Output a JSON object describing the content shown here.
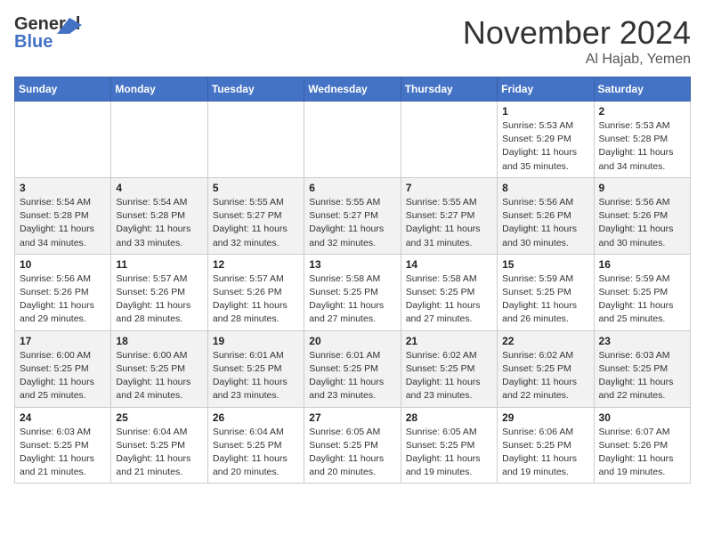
{
  "header": {
    "logo_line1": "General",
    "logo_line2": "Blue",
    "month": "November 2024",
    "location": "Al Hajab, Yemen"
  },
  "weekdays": [
    "Sunday",
    "Monday",
    "Tuesday",
    "Wednesday",
    "Thursday",
    "Friday",
    "Saturday"
  ],
  "weeks": [
    [
      {
        "day": "",
        "info": ""
      },
      {
        "day": "",
        "info": ""
      },
      {
        "day": "",
        "info": ""
      },
      {
        "day": "",
        "info": ""
      },
      {
        "day": "",
        "info": ""
      },
      {
        "day": "1",
        "info": "Sunrise: 5:53 AM\nSunset: 5:29 PM\nDaylight: 11 hours\nand 35 minutes."
      },
      {
        "day": "2",
        "info": "Sunrise: 5:53 AM\nSunset: 5:28 PM\nDaylight: 11 hours\nand 34 minutes."
      }
    ],
    [
      {
        "day": "3",
        "info": "Sunrise: 5:54 AM\nSunset: 5:28 PM\nDaylight: 11 hours\nand 34 minutes."
      },
      {
        "day": "4",
        "info": "Sunrise: 5:54 AM\nSunset: 5:28 PM\nDaylight: 11 hours\nand 33 minutes."
      },
      {
        "day": "5",
        "info": "Sunrise: 5:55 AM\nSunset: 5:27 PM\nDaylight: 11 hours\nand 32 minutes."
      },
      {
        "day": "6",
        "info": "Sunrise: 5:55 AM\nSunset: 5:27 PM\nDaylight: 11 hours\nand 32 minutes."
      },
      {
        "day": "7",
        "info": "Sunrise: 5:55 AM\nSunset: 5:27 PM\nDaylight: 11 hours\nand 31 minutes."
      },
      {
        "day": "8",
        "info": "Sunrise: 5:56 AM\nSunset: 5:26 PM\nDaylight: 11 hours\nand 30 minutes."
      },
      {
        "day": "9",
        "info": "Sunrise: 5:56 AM\nSunset: 5:26 PM\nDaylight: 11 hours\nand 30 minutes."
      }
    ],
    [
      {
        "day": "10",
        "info": "Sunrise: 5:56 AM\nSunset: 5:26 PM\nDaylight: 11 hours\nand 29 minutes."
      },
      {
        "day": "11",
        "info": "Sunrise: 5:57 AM\nSunset: 5:26 PM\nDaylight: 11 hours\nand 28 minutes."
      },
      {
        "day": "12",
        "info": "Sunrise: 5:57 AM\nSunset: 5:26 PM\nDaylight: 11 hours\nand 28 minutes."
      },
      {
        "day": "13",
        "info": "Sunrise: 5:58 AM\nSunset: 5:25 PM\nDaylight: 11 hours\nand 27 minutes."
      },
      {
        "day": "14",
        "info": "Sunrise: 5:58 AM\nSunset: 5:25 PM\nDaylight: 11 hours\nand 27 minutes."
      },
      {
        "day": "15",
        "info": "Sunrise: 5:59 AM\nSunset: 5:25 PM\nDaylight: 11 hours\nand 26 minutes."
      },
      {
        "day": "16",
        "info": "Sunrise: 5:59 AM\nSunset: 5:25 PM\nDaylight: 11 hours\nand 25 minutes."
      }
    ],
    [
      {
        "day": "17",
        "info": "Sunrise: 6:00 AM\nSunset: 5:25 PM\nDaylight: 11 hours\nand 25 minutes."
      },
      {
        "day": "18",
        "info": "Sunrise: 6:00 AM\nSunset: 5:25 PM\nDaylight: 11 hours\nand 24 minutes."
      },
      {
        "day": "19",
        "info": "Sunrise: 6:01 AM\nSunset: 5:25 PM\nDaylight: 11 hours\nand 23 minutes."
      },
      {
        "day": "20",
        "info": "Sunrise: 6:01 AM\nSunset: 5:25 PM\nDaylight: 11 hours\nand 23 minutes."
      },
      {
        "day": "21",
        "info": "Sunrise: 6:02 AM\nSunset: 5:25 PM\nDaylight: 11 hours\nand 23 minutes."
      },
      {
        "day": "22",
        "info": "Sunrise: 6:02 AM\nSunset: 5:25 PM\nDaylight: 11 hours\nand 22 minutes."
      },
      {
        "day": "23",
        "info": "Sunrise: 6:03 AM\nSunset: 5:25 PM\nDaylight: 11 hours\nand 22 minutes."
      }
    ],
    [
      {
        "day": "24",
        "info": "Sunrise: 6:03 AM\nSunset: 5:25 PM\nDaylight: 11 hours\nand 21 minutes."
      },
      {
        "day": "25",
        "info": "Sunrise: 6:04 AM\nSunset: 5:25 PM\nDaylight: 11 hours\nand 21 minutes."
      },
      {
        "day": "26",
        "info": "Sunrise: 6:04 AM\nSunset: 5:25 PM\nDaylight: 11 hours\nand 20 minutes."
      },
      {
        "day": "27",
        "info": "Sunrise: 6:05 AM\nSunset: 5:25 PM\nDaylight: 11 hours\nand 20 minutes."
      },
      {
        "day": "28",
        "info": "Sunrise: 6:05 AM\nSunset: 5:25 PM\nDaylight: 11 hours\nand 19 minutes."
      },
      {
        "day": "29",
        "info": "Sunrise: 6:06 AM\nSunset: 5:25 PM\nDaylight: 11 hours\nand 19 minutes."
      },
      {
        "day": "30",
        "info": "Sunrise: 6:07 AM\nSunset: 5:26 PM\nDaylight: 11 hours\nand 19 minutes."
      }
    ]
  ]
}
